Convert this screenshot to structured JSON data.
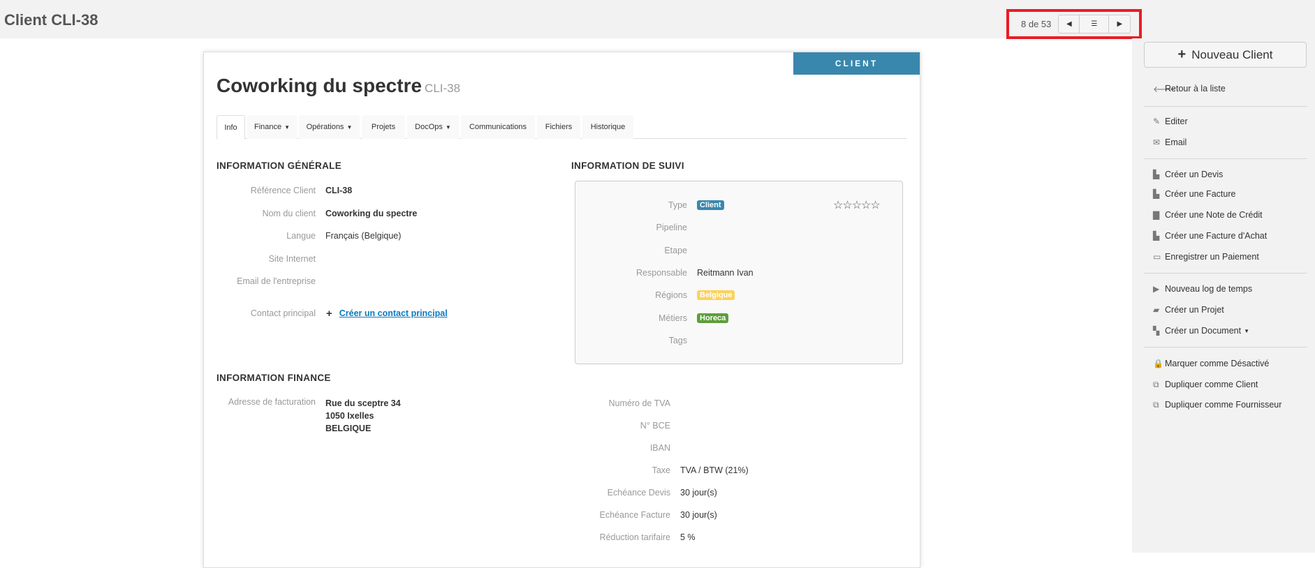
{
  "header": {
    "title": "Client CLI-38",
    "pager": {
      "count": "8 de 53",
      "prev_icon": "caret-left-icon",
      "list_icon": "list-icon",
      "next_icon": "caret-right-icon"
    }
  },
  "sidebar": {
    "new_button": "Nouveau Client",
    "items": [
      {
        "label": "Retour à la liste",
        "icon": "arrow-left-icon",
        "glyph": "🡐"
      },
      {
        "label": "Editer",
        "icon": "pencil-icon",
        "glyph": "✎"
      },
      {
        "label": "Email",
        "icon": "envelope-icon",
        "glyph": "✉"
      },
      {
        "label": "Créer un Devis",
        "icon": "file-icon",
        "glyph": "▙"
      },
      {
        "label": "Créer une Facture",
        "icon": "file-text-icon",
        "glyph": "▙"
      },
      {
        "label": "Créer une Note de Crédit",
        "icon": "note-icon",
        "glyph": "▇"
      },
      {
        "label": "Créer une Facture d'Achat",
        "icon": "file-text-icon",
        "glyph": "▙"
      },
      {
        "label": "Enregistrer un Paiement",
        "icon": "credit-card-icon",
        "glyph": "▭"
      },
      {
        "label": "Nouveau log de temps",
        "icon": "play-icon",
        "glyph": "▶"
      },
      {
        "label": "Créer un Projet",
        "icon": "folder-open-icon",
        "glyph": "▰"
      },
      {
        "label": "Créer un Document",
        "icon": "documents-icon",
        "glyph": "▚",
        "caret": true
      },
      {
        "label": "Marquer comme Désactivé",
        "icon": "lock-icon",
        "glyph": "🔒"
      },
      {
        "label": "Dupliquer comme Client",
        "icon": "duplicate-icon",
        "glyph": "⧉"
      },
      {
        "label": "Dupliquer comme Fournisseur",
        "icon": "duplicate-icon",
        "glyph": "⧉"
      }
    ]
  },
  "card": {
    "banner": "CLIENT",
    "title": "Coworking du spectre",
    "ref": "CLI-38",
    "tabs": [
      {
        "label": "Info",
        "active": true
      },
      {
        "label": "Finance",
        "caret": true
      },
      {
        "label": "Opérations",
        "caret": true
      },
      {
        "label": "Projets"
      },
      {
        "label": "DocOps",
        "caret": true
      },
      {
        "label": "Communications"
      },
      {
        "label": "Fichiers"
      },
      {
        "label": "Historique"
      }
    ],
    "general": {
      "heading": "INFORMATION GÉNÉRALE",
      "rows": [
        {
          "label": "Référence Client",
          "value": "CLI-38"
        },
        {
          "label": "Nom du client",
          "value": "Coworking du spectre"
        },
        {
          "label": "Langue",
          "value": "Français (Belgique)"
        },
        {
          "label": "Site Internet",
          "value": ""
        },
        {
          "label": "Email de l'entreprise",
          "value": ""
        }
      ],
      "contact_label": "Contact principal",
      "contact_link": "Créer un contact principal"
    },
    "suivi": {
      "heading": "INFORMATION DE SUIVI",
      "rating": 0,
      "rating_max": 5,
      "rows": [
        {
          "label": "Type",
          "badge": "Client",
          "color": "#3a87ad"
        },
        {
          "label": "Pipeline",
          "value": ""
        },
        {
          "label": "Etape",
          "value": ""
        },
        {
          "label": "Responsable",
          "value": "Reitmann Ivan"
        },
        {
          "label": "Régions",
          "badge": "Belgique",
          "color": "#fcd25c"
        },
        {
          "label": "Métiers",
          "badge": "Horeca",
          "color": "#5e9e3c"
        },
        {
          "label": "Tags",
          "value": ""
        }
      ]
    },
    "finance": {
      "heading": "INFORMATION FINANCE",
      "address_label": "Adresse de facturation",
      "address": [
        "Rue du sceptre 34",
        "1050 Ixelles",
        "BELGIQUE"
      ],
      "rows": [
        {
          "label": "Numéro de TVA",
          "value": ""
        },
        {
          "label": "N° BCE",
          "value": ""
        },
        {
          "label": "IBAN",
          "value": ""
        },
        {
          "label": "Taxe",
          "value": "TVA / BTW (21%)"
        },
        {
          "label": "Echéance Devis",
          "value": "30 jour(s)"
        },
        {
          "label": "Echéance Facture",
          "value": "30 jour(s)"
        },
        {
          "label": "Réduction tarifaire",
          "value": "5 %"
        }
      ]
    }
  }
}
